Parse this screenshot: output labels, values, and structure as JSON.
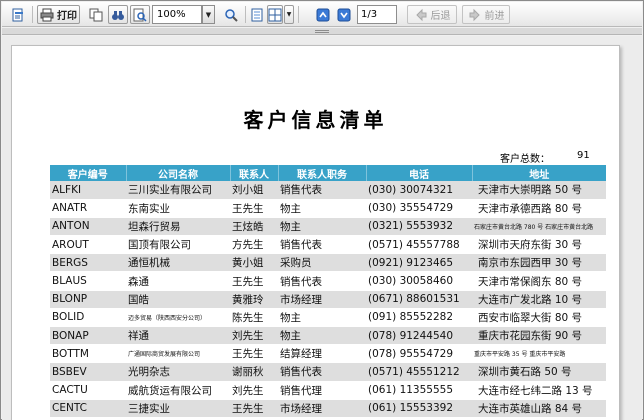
{
  "toolbar": {
    "print_label": "打印",
    "zoom_value": "100%",
    "page_value": "1/3",
    "back_label": "后退",
    "forward_label": "前进"
  },
  "report": {
    "title": "客户信息清单",
    "count_label": "客户总数：",
    "count_value": "91",
    "columns": [
      "客户编号",
      "公司名称",
      "联系人",
      "联系人职务",
      "电话",
      "地址"
    ],
    "rows": [
      [
        "ALFKI",
        "三川实业有限公司",
        "刘小姐",
        "销售代表",
        "(030) 30074321",
        "天津市大崇明路 50 号"
      ],
      [
        "ANATR",
        "东南实业",
        "王先生",
        "物主",
        "(030) 35554729",
        "天津市承德西路 80 号"
      ],
      [
        "ANTON",
        "坦森行贸易",
        "王炫皓",
        "物主",
        "(0321) 5553932",
        "石家庄市黄台北路 780 号 石家庄市黄台北路"
      ],
      [
        "AROUT",
        "国顶有限公司",
        "方先生",
        "销售代表",
        "(0571) 45557788",
        "深圳市天府东街 30 号"
      ],
      [
        "BERGS",
        "通恒机械",
        "黄小姐",
        "采购员",
        "(0921) 9123465",
        "南京市东园西甲 30 号"
      ],
      [
        "BLAUS",
        "森通",
        "王先生",
        "销售代表",
        "(030) 30058460",
        "天津市常保阁东 80 号"
      ],
      [
        "BLONP",
        "国皓",
        "黄雅玲",
        "市场经理",
        "(0671) 88601531",
        "大连市广发北路 10 号"
      ],
      [
        "BOLID",
        "迈多贸易（陕西西安分公司）",
        "陈先生",
        "物主",
        "(091) 85552282",
        "西安市临翠大街 80 号"
      ],
      [
        "BONAP",
        "祥通",
        "刘先生",
        "物主",
        "(078) 91244540",
        "重庆市花园东街 90 号"
      ],
      [
        "BOTTM",
        "广通国际商贸发展有限公司",
        "王先生",
        "结算经理",
        "(078) 95554729",
        "重庆市平安路 35 号 重庆市平安路"
      ],
      [
        "BSBEV",
        "光明杂志",
        "谢丽秋",
        "销售代表",
        "(0571) 45551212",
        "深圳市黄石路 50 号"
      ],
      [
        "CACTU",
        "威航货运有限公司",
        "刘先生",
        "销售代理",
        "(061) 11355555",
        "大连市经七纬二路 13 号"
      ],
      [
        "CENTC",
        "三捷实业",
        "王先生",
        "市场经理",
        "(061) 15553392",
        "大连市英雄山路 84 号"
      ]
    ]
  }
}
